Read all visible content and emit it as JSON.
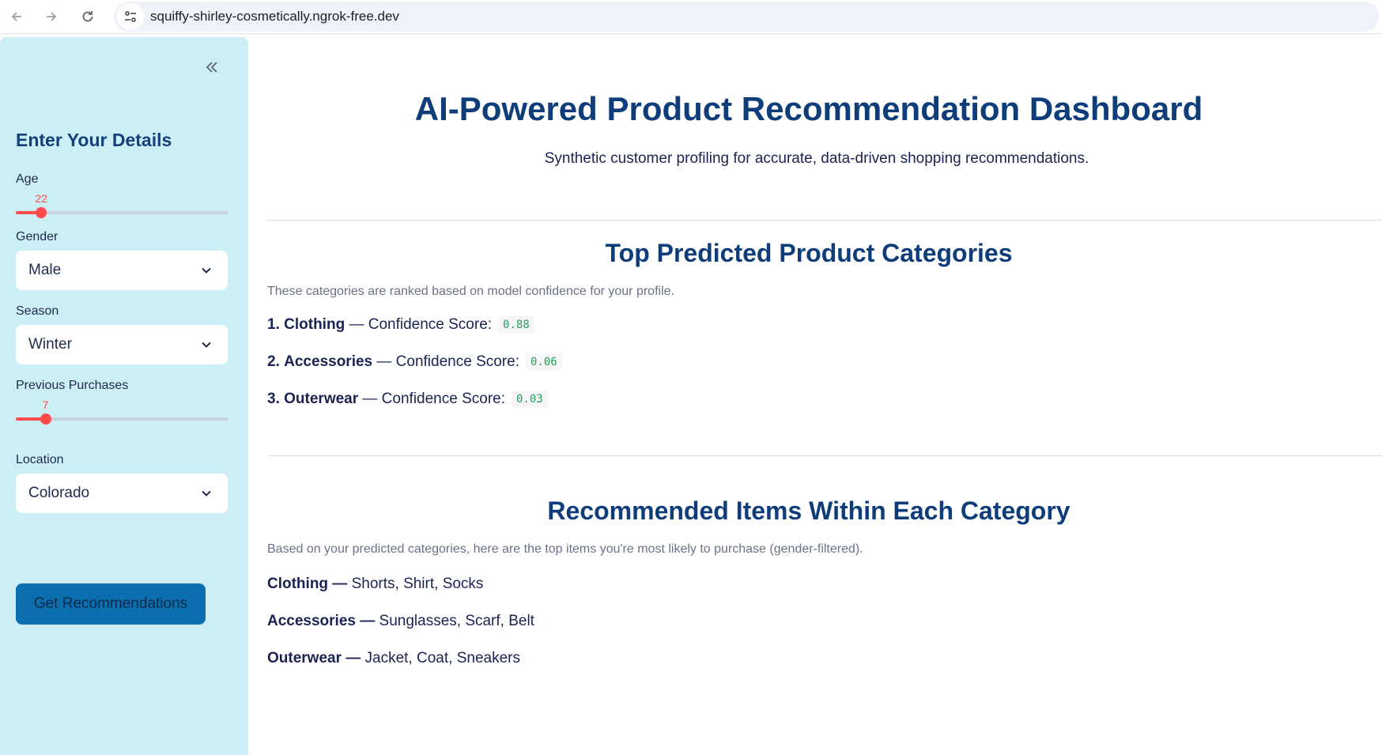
{
  "browser": {
    "url": "squiffy-shirley-cosmetically.ngrok-free.dev",
    "icons": [
      "back-arrow-icon",
      "forward-arrow-icon",
      "reload-icon",
      "site-settings-icon"
    ]
  },
  "sidebar": {
    "collapse_icon": "double-chevron-left-icon",
    "heading": "Enter Your Details",
    "age": {
      "label": "Age",
      "value": "22",
      "fraction": 0.12
    },
    "gender": {
      "label": "Gender",
      "value": "Male"
    },
    "season": {
      "label": "Season",
      "value": "Winter"
    },
    "previous_purchases": {
      "label": "Previous Purchases",
      "value": "7",
      "fraction": 0.14
    },
    "location": {
      "label": "Location",
      "value": "Colorado"
    },
    "submit_label": "Get Recommendations"
  },
  "main": {
    "title": "AI-Powered Product Recommendation Dashboard",
    "subtitle": "Synthetic customer profiling for accurate, data-driven shopping recommendations.",
    "categories_section": {
      "title": "Top Predicted Product Categories",
      "description": "These categories are ranked based on model confidence for your profile.",
      "items": [
        {
          "rank": "1.",
          "name": "Clothing",
          "label": "— Confidence Score:",
          "score": "0.88"
        },
        {
          "rank": "2.",
          "name": "Accessories",
          "label": "— Confidence Score:",
          "score": "0.06"
        },
        {
          "rank": "3.",
          "name": "Outerwear",
          "label": "— Confidence Score:",
          "score": "0.03"
        }
      ]
    },
    "items_section": {
      "title": "Recommended Items Within Each Category",
      "description": "Based on your predicted categories, here are the top items you're most likely to purchase (gender-filtered).",
      "rows": [
        {
          "category": "Clothing —",
          "items": "Shorts, Shirt, Socks"
        },
        {
          "category": "Accessories —",
          "items": "Sunglasses, Scarf, Belt"
        },
        {
          "category": "Outerwear —",
          "items": "Jacket, Coat, Sneakers"
        }
      ]
    }
  },
  "colors": {
    "sidebar_bg": "#cbeff5",
    "heading": "#0f3d7a",
    "slider_accent": "#ff4b4b",
    "button_bg": "#0b6eae",
    "score_text": "#21a05a"
  }
}
